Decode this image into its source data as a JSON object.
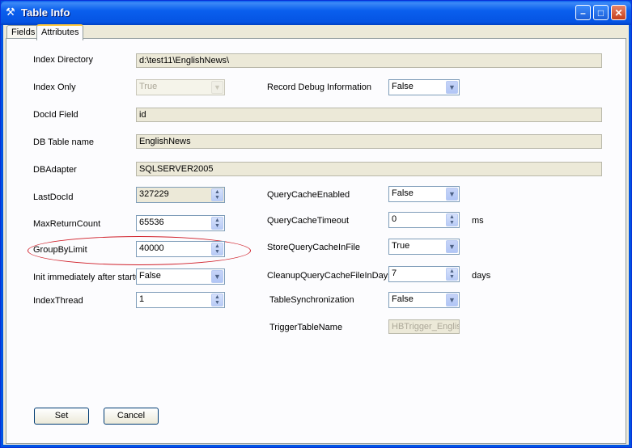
{
  "window": {
    "title": "Table Info",
    "icon": "database-key-icon"
  },
  "tabs": [
    {
      "label": "Fields"
    },
    {
      "label": "Attributes"
    }
  ],
  "left": {
    "index_directory": {
      "label": "Index Directory",
      "value": "d:\\test11\\EnglishNews\\"
    },
    "index_only": {
      "label": "Index Only",
      "value": "True"
    },
    "docid_field": {
      "label": "DocId Field",
      "value": "id"
    },
    "db_table_name": {
      "label": "DB Table name",
      "value": "EnglishNews"
    },
    "db_adapter": {
      "label": "DBAdapter",
      "value": "SQLSERVER2005"
    },
    "last_docid": {
      "label": "LastDocId",
      "value": "327229"
    },
    "max_return_count": {
      "label": "MaxReturnCount",
      "value": "65536"
    },
    "group_by_limit": {
      "label": "GroupByLimit",
      "value": "40000"
    },
    "init_after_startup": {
      "label": "Init immediately after startup",
      "value": "False"
    },
    "index_thread": {
      "label": "IndexThread",
      "value": "1"
    }
  },
  "right": {
    "record_debug": {
      "label": "Record Debug Information",
      "value": "False"
    },
    "query_cache_enabled": {
      "label": "QueryCacheEnabled",
      "value": "False"
    },
    "query_cache_timeout": {
      "label": "QueryCacheTimeout",
      "value": "0",
      "unit": "ms"
    },
    "store_query_cache": {
      "label": "StoreQueryCacheInFile",
      "value": "True"
    },
    "cleanup_days": {
      "label": "CleanupQueryCacheFileInDays",
      "value": "7",
      "unit": "days"
    },
    "table_sync": {
      "label": "TableSynchronization",
      "value": "False"
    },
    "trigger_table_name": {
      "label": "TriggerTableName",
      "value": "HBTrigger_Englishl"
    }
  },
  "buttons": {
    "set": "Set",
    "cancel": "Cancel"
  },
  "colors": {
    "titlebar": "#0054e3",
    "highlight_ellipse": "#d0202a",
    "dialog_bg": "#ece9d8"
  }
}
